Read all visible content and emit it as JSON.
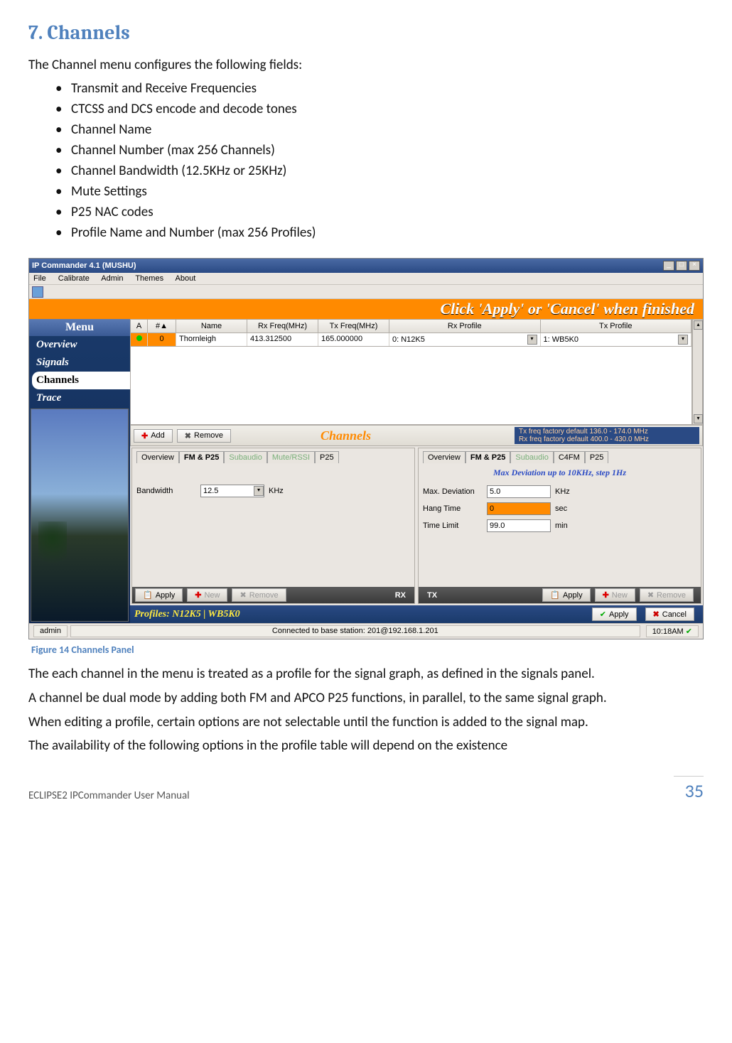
{
  "section": {
    "title": "7. Channels"
  },
  "intro": "The Channel menu configures the following fields:",
  "bullets": [
    "Transmit and Receive Frequencies",
    "CTCSS and DCS encode and decode tones",
    "Channel Name",
    "Channel Number (max 256 Channels)",
    "Channel Bandwidth (12.5KHz or 25KHz)",
    "Mute Settings",
    "P25 NAC codes",
    "Profile Name and Number (max 256 Profiles)"
  ],
  "app": {
    "title": "IP Commander 4.1 (MUSHU)",
    "menus": [
      "File",
      "Calibrate",
      "Admin",
      "Themes",
      "About"
    ],
    "banner": "Click  'Apply'  or  'Cancel'  when finished",
    "sidebar": {
      "title": "Menu",
      "items": [
        "Overview",
        "Signals",
        "Channels",
        "Trace"
      ],
      "selected_index": 2
    },
    "grid": {
      "headers": [
        "A",
        "#▲",
        "Name",
        "Rx Freq(MHz)",
        "Tx Freq(MHz)",
        "Rx Profile",
        "Tx Profile"
      ],
      "row": {
        "num": "0",
        "name": "Thornleigh",
        "rx": "413.312500",
        "tx": "165.000000",
        "rx_profile": "0: N12K5",
        "tx_profile": "1: WB5K0"
      }
    },
    "channels_bar": {
      "add": "Add",
      "remove": "Remove",
      "title": "Channels",
      "tx_default": "Tx freq factory default 136.0 - 174.0 MHz",
      "rx_default": "Rx freq factory default 400.0 - 430.0 MHz"
    },
    "rx_panel": {
      "tabs": [
        "Overview",
        "FM & P25",
        "Subaudio",
        "Mute/RSSI",
        "P25"
      ],
      "active_index": 1,
      "bandwidth_label": "Bandwidth",
      "bandwidth_value": "12.5",
      "bandwidth_unit": "KHz",
      "footer": {
        "apply": "Apply",
        "new": "New",
        "remove": "Remove",
        "label": "RX"
      }
    },
    "tx_panel": {
      "tabs": [
        "Overview",
        "FM & P25",
        "Subaudio",
        "C4FM",
        "P25"
      ],
      "active_index": 1,
      "hint": "Max Deviation up to 10KHz, step 1Hz",
      "rows": [
        {
          "label": "Max. Deviation",
          "value": "5.0",
          "unit": "KHz",
          "orange": false
        },
        {
          "label": "Hang Time",
          "value": "0",
          "unit": "sec",
          "orange": true
        },
        {
          "label": "Time Limit",
          "value": "99.0",
          "unit": "min",
          "orange": false
        }
      ],
      "footer": {
        "label": "TX",
        "apply": "Apply",
        "new": "New",
        "remove": "Remove"
      }
    },
    "profiles_bar": {
      "text": "Profiles: N12K5 | WB5K0",
      "apply": "Apply",
      "cancel": "Cancel"
    },
    "statusbar": {
      "user": "admin",
      "conn": "Connected to base station: 201@192.168.1.201",
      "time": "10:18AM"
    }
  },
  "figure_caption": "Figure 14 Channels Panel",
  "para1": "The each channel in the menu is treated as a profile for the signal graph, as defined in the signals panel.",
  "para2": "A channel be dual mode by adding both FM and APCO P25 functions, in parallel, to the same signal graph.",
  "para3": "When editing a profile, certain options are not selectable until the function is added to the signal map.",
  "para4": "The availability of the following options in the profile table will depend on the existence",
  "footer": {
    "doc": "ECLIPSE2 IPCommander User Manual",
    "page": "35"
  }
}
